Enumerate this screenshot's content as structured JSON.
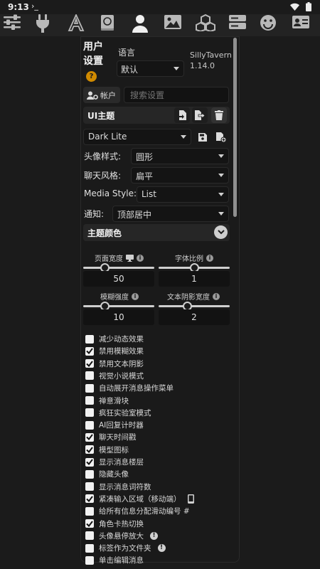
{
  "status_bar": {
    "time": "9:13",
    "notification": "›_"
  },
  "toolbar": {
    "icons": [
      "sliders-icon",
      "plug-icon",
      "font-icon",
      "book-icon",
      "user-icon",
      "image-icon",
      "cubes-icon",
      "server-icon",
      "smiley-icon",
      "id-card-icon"
    ],
    "active": "user-icon",
    "color_active": "#f0f0f0",
    "color_inactive": "#b8b8b8"
  },
  "panel": {
    "title": "用户设置",
    "help_label": "?",
    "language_label": "语言",
    "language_value": "默认",
    "app_name": "SillyTavern",
    "version": "1.14.0",
    "account_button": "帐户",
    "search_placeholder": "搜索设置",
    "ui_theme_label": "UI主题",
    "theme_value": "Dark Lite",
    "avatar_style_label": "头像样式:",
    "avatar_style_value": "圆形",
    "chat_style_label": "聊天风格:",
    "chat_style_value": "扁平",
    "media_style_label": "Media Style:",
    "media_style_value": "List",
    "notify_label": "通知:",
    "notify_value": "顶部居中",
    "theme_colors_label": "主题颜色"
  },
  "sliders": [
    {
      "label": "页面宽度",
      "value": "50",
      "fraction": 0.3
    },
    {
      "label": "字体比例",
      "value": "1",
      "fraction": 0.5
    },
    {
      "label": "模糊强度",
      "value": "10",
      "fraction": 0.3
    },
    {
      "label": "文本阴影宽度",
      "value": "2",
      "fraction": 0.4
    }
  ],
  "checkboxes": [
    {
      "label": "减少动态效果",
      "checked": false
    },
    {
      "label": "禁用模糊效果",
      "checked": true
    },
    {
      "label": "禁用文本阴影",
      "checked": true
    },
    {
      "label": "视觉小说模式",
      "checked": false
    },
    {
      "label": "自动展开消息操作菜单",
      "checked": false
    },
    {
      "label": "禅意滑块",
      "checked": false
    },
    {
      "label": "疯狂实验室模式",
      "checked": false
    },
    {
      "label": "AI回复计时器",
      "checked": false
    },
    {
      "label": "聊天时间戳",
      "checked": true
    },
    {
      "label": "模型图标",
      "checked": true
    },
    {
      "label": "显示消息楼层",
      "checked": true
    },
    {
      "label": "隐藏头像",
      "checked": false
    },
    {
      "label": "显示消息词符数",
      "checked": false
    },
    {
      "label": "紧凑输入区域（移动端）",
      "checked": true,
      "extra": "mobile-icon"
    },
    {
      "label": "给所有信息分配滑动编号 #",
      "checked": false
    },
    {
      "label": "角色卡热切换",
      "checked": true
    },
    {
      "label": "头像悬停放大",
      "checked": false,
      "extra": "warning-icon"
    },
    {
      "label": "标签作为文件夹",
      "checked": false,
      "extra": "warning-icon"
    },
    {
      "label": "单击编辑消息",
      "checked": false
    }
  ]
}
